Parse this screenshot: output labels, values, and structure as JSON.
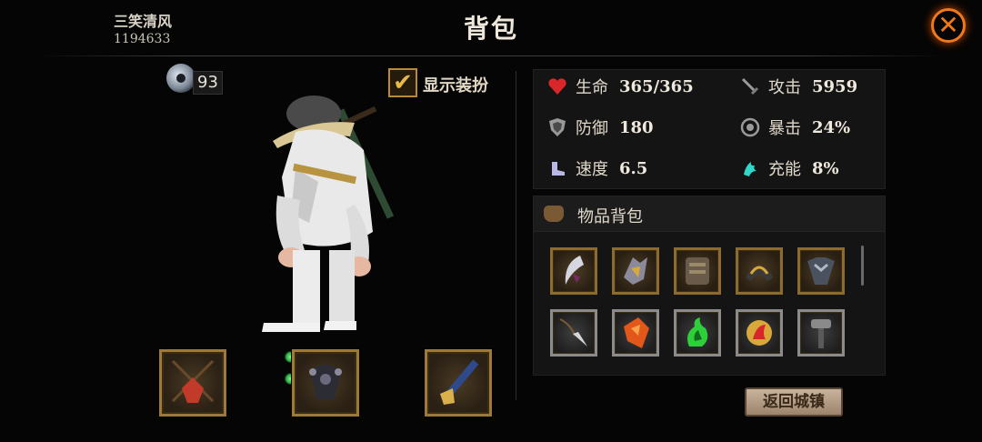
{
  "header": {
    "player_name": "三笑清风",
    "player_id": "1194633",
    "title": "背包",
    "close_icon": "close-x-icon"
  },
  "character_panel": {
    "gem_count": "93",
    "show_costume_label": "显示装扮",
    "show_costume_checked": true,
    "equipment_slots": [
      {
        "icon": "red-amulet-icon"
      },
      {
        "icon": "dark-armor-icon",
        "gems": 2
      },
      {
        "icon": "golden-staff-icon"
      }
    ]
  },
  "stats": {
    "hp_label": "生命",
    "hp_value": "365/365",
    "attack_label": "攻击",
    "attack_value": "5959",
    "defense_label": "防御",
    "defense_value": "180",
    "crit_label": "暴击",
    "crit_value": "24%",
    "speed_label": "速度",
    "speed_value": "6.5",
    "energy_label": "充能",
    "energy_value": "8%"
  },
  "inventory": {
    "title": "物品背包",
    "items": [
      {
        "icon": "crescent-blade-icon"
      },
      {
        "icon": "golden-gauntlet-icon"
      },
      {
        "icon": "chest-armor-icon"
      },
      {
        "icon": "helmet-icon"
      },
      {
        "icon": "spiked-armor-icon"
      },
      {
        "icon": "dagger-necklace-icon"
      },
      {
        "icon": "orange-shard-icon"
      },
      {
        "icon": "green-flame-icon"
      },
      {
        "icon": "fire-orb-icon"
      },
      {
        "icon": "iron-hammer-icon"
      }
    ]
  },
  "footer": {
    "return_button": "返回城镇"
  },
  "colors": {
    "gold_frame": "#9e7a36",
    "close_accent": "#f07a1a",
    "panel_bg": "#141414"
  }
}
